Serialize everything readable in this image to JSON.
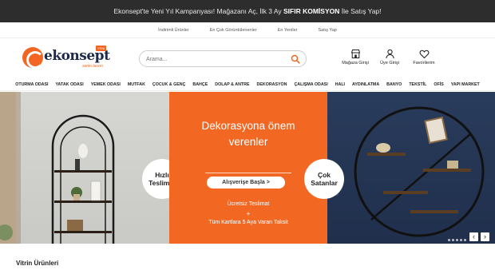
{
  "announcement": {
    "prefix": "Ekonsept'te Yeni Yıl Kampanyası! Mağazanı Aç, İlk 3 Ay",
    "highlight": "SIFIR KOMİSYON",
    "suffix": "İle Satış Yap!"
  },
  "subnav": [
    "İndirimli Ürünler",
    "En Çok Görüntülenenler",
    "En Yeniler",
    "Satış Yap"
  ],
  "logo": {
    "text": "ekonsept",
    "tagline": "senin tarzın",
    "badge": "YENİ"
  },
  "search": {
    "placeholder": "Arama..."
  },
  "header_icons": {
    "store": "Mağaza Girişi",
    "member": "Üye Girişi",
    "favorites": "Favorilerim"
  },
  "menu": [
    "OTURMA ODASI",
    "YATAK ODASI",
    "YEMEK ODASI",
    "MUTFAK",
    "ÇOCUK & GENÇ",
    "BAHÇE",
    "DOLAP & ANTRE",
    "DEKORASYON",
    "ÇALIŞMA ODASI",
    "HALI",
    "AYDINLATMA",
    "BANYO",
    "TEKSTİL",
    "OFİS",
    "YAPI MARKET"
  ],
  "banner": {
    "bubble_left": "Hızlı Teslimat",
    "bubble_right": "Çok Satanlar",
    "headline_line1": "Dekorasyona önem",
    "headline_line2": "verenler",
    "cta": "Alışverişe Başla >",
    "feature1": "Ücretsiz Teslimat",
    "feature_plus": "+",
    "feature2": "Tüm Kartlara 5 Aya Varan Taksit",
    "prev": "‹",
    "next": "›"
  },
  "section_title": "Vitrin Ürünleri",
  "colors": {
    "brand": "#f26522",
    "topbar": "#2d2d2d",
    "navy": "#1e2a4a"
  }
}
